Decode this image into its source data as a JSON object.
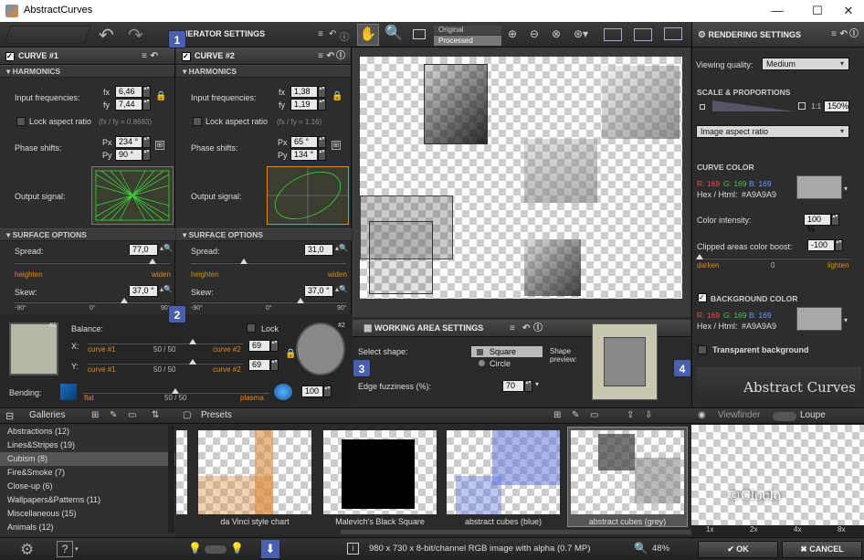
{
  "window": {
    "title": "AbstractCurves",
    "min": "—",
    "max": "☐",
    "close": "✕"
  },
  "generator": {
    "title": "GENERATOR SETTINGS"
  },
  "curve1": {
    "title": "CURVE #1",
    "harmonics": "HARMONICS",
    "input_freq_label": "Input frequencies:",
    "fx_label": "fx",
    "fy_label": "fy",
    "fx": "6,46",
    "fy": "7,44",
    "lock_aspect": "Lock aspect ratio",
    "ratio": "(fx / fy = 0.8683)",
    "phase_label": "Phase shifts:",
    "px_label": "Px",
    "py_label": "Py",
    "px": "234 °",
    "py": "90 °",
    "output_label": "Output signal:",
    "surface": "SURFACE OPTIONS",
    "spread_label": "Spread:",
    "spread": "77,0",
    "heighten": "heighten",
    "widen": "widen",
    "skew_label": "Skew:",
    "skew": "37,0 °",
    "skew_min": "-90°",
    "skew_mid": "0°",
    "skew_max": "90°"
  },
  "curve2": {
    "title": "CURVE #2",
    "harmonics": "HARMONICS",
    "input_freq_label": "Input frequencies:",
    "fx_label": "fx",
    "fy_label": "fy",
    "fx": "1,38",
    "fy": "1,19",
    "lock_aspect": "Lock aspect ratio",
    "ratio": "(fx / fy = 1.16)",
    "phase_label": "Phase shifts:",
    "px_label": "Px",
    "py_label": "Py",
    "px": "65 °",
    "py": "134 °",
    "output_label": "Output signal:",
    "surface": "SURFACE OPTIONS",
    "spread_label": "Spread:",
    "spread": "31,0",
    "heighten": "heighten",
    "widen": "widen",
    "skew_label": "Skew:",
    "skew": "37,0 °",
    "skew_min": "-90°",
    "skew_mid": "0°",
    "skew_max": "90°"
  },
  "balance": {
    "label": "Balance:",
    "lock": "Lock",
    "x_label": "X:",
    "y_label": "Y:",
    "curve1": "curve #1",
    "curve2": "curve #2",
    "x_mid": "50 / 50",
    "y_mid": "50 / 50",
    "x_val": "69",
    "y_val": "69",
    "badge1": "#1",
    "badge2": "#2"
  },
  "bending": {
    "label": "Bending:",
    "flat": "flat",
    "mid": "50 / 50",
    "plasma": "plasma",
    "value": "100"
  },
  "preview_toggle": {
    "original": "Original",
    "processed": "Processed"
  },
  "working_area": {
    "title": "WORKING AREA SETTINGS",
    "select_shape": "Select shape:",
    "square": "Square",
    "circle": "Circle",
    "shape_preview": "Shape preview:",
    "fuzz_label": "Edge fuzziness (%):",
    "fuzz": "70"
  },
  "rendering": {
    "title": "RENDERING SETTINGS",
    "viewing_quality_label": "Viewing quality:",
    "viewing_quality": "Medium",
    "scale": "SCALE & PROPORTIONS",
    "ratio11": "1:1",
    "zoom": "150%",
    "aspect": "Image aspect ratio",
    "curve_color": "CURVE COLOR",
    "r_label": "R: 169",
    "g_label": "G: 169",
    "b_label": "B: 169",
    "hex_label": "Hex / Html:",
    "hex": "#A9A9A9",
    "intensity_label": "Color intensity:",
    "intensity": "100 %",
    "boost_label": "Clipped areas color boost:",
    "boost": "-100",
    "darken": "darken",
    "boost_mid": "0",
    "lighten": "lighten",
    "bg_color": "BACKGROUND COLOR",
    "bg_r": "R: 169",
    "bg_g": "G: 169",
    "bg_b": "B: 169",
    "bg_hex": "#A9A9A9",
    "transparent": "Transparent background",
    "logo": "Abstract Curves"
  },
  "steps": [
    "1",
    "2",
    "3",
    "4"
  ],
  "galleries": {
    "title": "Galleries",
    "items": [
      {
        "label": "Abstractions (12)"
      },
      {
        "label": "Lines&Stripes (19)"
      },
      {
        "label": "Cubism (8)"
      },
      {
        "label": "Fire&Smoke (7)"
      },
      {
        "label": "Close-up (6)"
      },
      {
        "label": "Wallpapers&Patterns (11)"
      },
      {
        "label": "Miscellaneous (15)"
      },
      {
        "label": "Animals (12)"
      }
    ]
  },
  "presets": {
    "title": "Presets",
    "items": [
      {
        "caption": "da Vinci style chart"
      },
      {
        "caption": "Malevich's Black Square"
      },
      {
        "caption": "abstract cubes (blue)"
      },
      {
        "caption": "abstract cubes (grey)"
      }
    ]
  },
  "viewfinder": {
    "title": "Viewfinder",
    "loupe": "Loupe",
    "zooms": [
      "1x",
      "2x",
      "4x",
      "8x"
    ],
    "watermark": "©Cloclo"
  },
  "statusbar": {
    "info": "980 x 730 x 8-bit/channel RGB image with alpha  (0.7 MP)",
    "zoom": "48%",
    "ok": "OK",
    "cancel": "CANCEL"
  },
  "colors": {
    "accent_blue": "#4a5fb0",
    "orange": "#e08a1c",
    "green_signal": "#3bd13b",
    "curve_gray": "#A9A9A9"
  }
}
